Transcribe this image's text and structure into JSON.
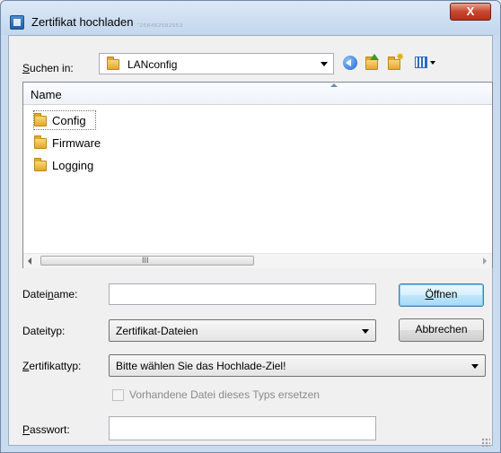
{
  "window": {
    "title": "Zertifikat hochladen",
    "title_suffix_obscured": "·₂₅₈₄₅₂₅₈₂₅₅₃",
    "close_label": "X"
  },
  "lookin": {
    "label": "Suchen in:",
    "label_accel": "S",
    "label_rest": "uchen in:",
    "value": "LANconfig",
    "toolbar_icons": [
      "back-icon",
      "up-folder-icon",
      "new-folder-icon",
      "view-menu-icon"
    ]
  },
  "file_list": {
    "column_header": "Name",
    "items": [
      {
        "name": "Config",
        "icon": "folder-icon"
      },
      {
        "name": "Firmware",
        "icon": "folder-icon"
      },
      {
        "name": "Logging",
        "icon": "folder-icon"
      }
    ],
    "scroll_grip": "III"
  },
  "form": {
    "filename_label_pre": "Datei",
    "filename_label_accel": "n",
    "filename_label_post": "ame:",
    "filename_value": "",
    "filetype_label": "Dateityp:",
    "filetype_value": "Zertifikat-Dateien",
    "certtype_label_accel": "Z",
    "certtype_label_rest": "ertifikattyp:",
    "certtype_value": "Bitte wählen Sie das Hochlade-Ziel!",
    "replace_checkbox_label": "Vorhandene Datei dieses Typs ersetzen",
    "replace_checked": false,
    "password_label_accel": "P",
    "password_label_rest": "asswort:",
    "password_value": ""
  },
  "buttons": {
    "open_accel": "Ö",
    "open_rest": "ffnen",
    "cancel": "Abbrechen"
  },
  "colors": {
    "title_bar": "#c9dbee",
    "close_button": "#c7462f",
    "default_button": "#bee6fd",
    "folder": "#f0c14b"
  }
}
